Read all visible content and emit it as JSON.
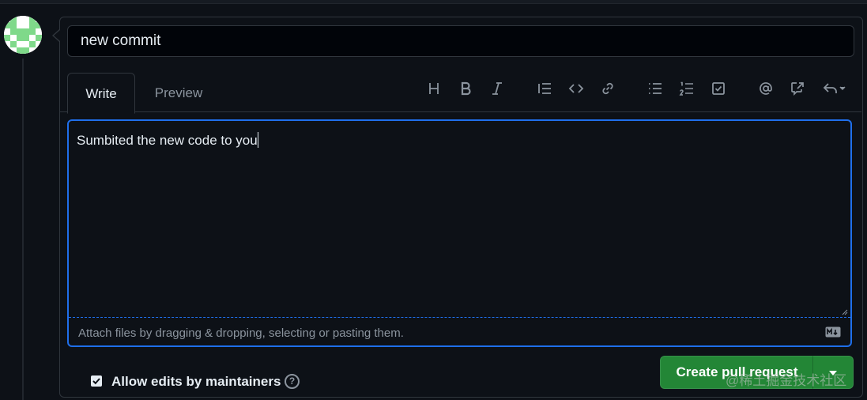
{
  "title_input": {
    "value": "new commit"
  },
  "tabs": [
    {
      "label": "Write",
      "active": true
    },
    {
      "label": "Preview",
      "active": false
    }
  ],
  "toolbar": [
    "heading-icon",
    "bold-icon",
    "italic-icon",
    "quote-icon",
    "code-icon",
    "link-icon",
    "bulleted-list-icon",
    "numbered-list-icon",
    "task-list-icon",
    "mention-icon",
    "reference-icon",
    "reply-icon"
  ],
  "editor": {
    "value": "Sumbited the new code to you",
    "attach_hint": "Attach files by dragging & dropping, selecting or pasting them."
  },
  "allow_edits": {
    "label": "Allow edits by maintainers",
    "checked": true
  },
  "actions": {
    "create_label": "Create pull request"
  },
  "watermark": "@稀土掘金技术社区",
  "colors": {
    "accent": "#1f6feb",
    "button": "#238636",
    "background": "#0d1117"
  }
}
